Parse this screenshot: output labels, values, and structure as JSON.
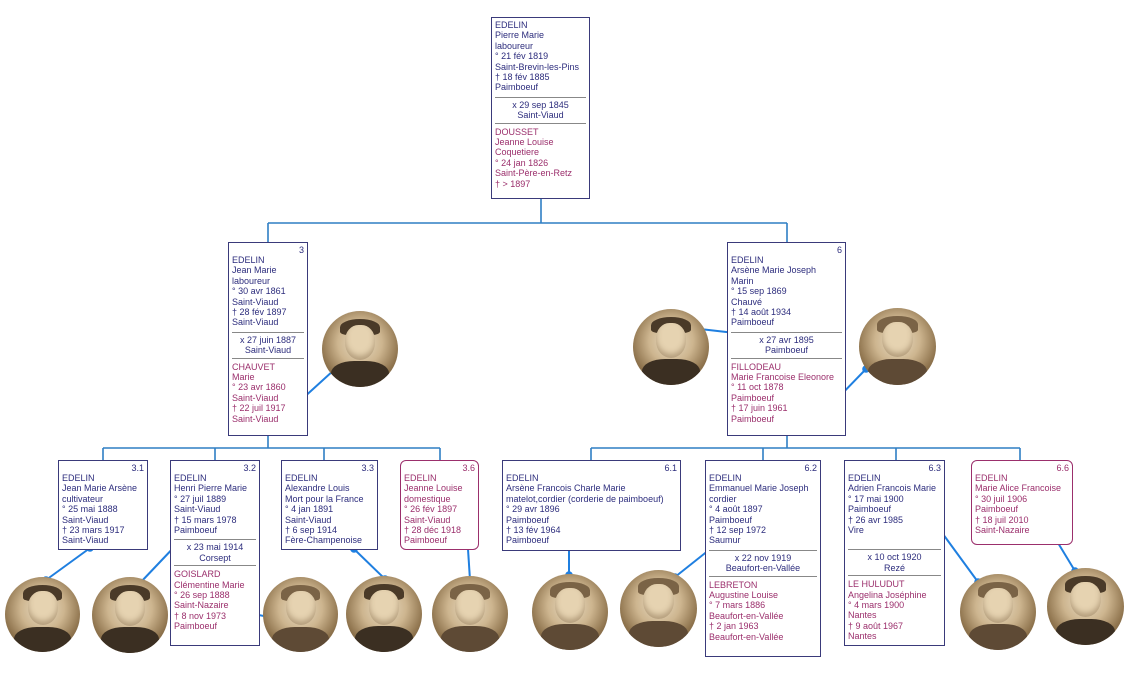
{
  "root": {
    "husband": [
      "EDELIN",
      "Pierre Marie",
      "laboureur",
      "° 21 fév 1819",
      "Saint-Brevin-les-Pins",
      "† 18 fév 1885",
      "Paimboeuf"
    ],
    "marriage": [
      "x 29 sep 1845",
      "Saint-Viaud"
    ],
    "wife": [
      "DOUSSET",
      "Jeanne Louise",
      "Coquetiere",
      "° 24 jan 1826",
      "Saint-Père-en-Retz",
      "† > 1897"
    ]
  },
  "couple3": {
    "num": "3",
    "husband": [
      "EDELIN",
      "Jean Marie",
      "laboureur",
      "° 30 avr 1861",
      "Saint-Viaud",
      "† 28 fév 1897",
      "Saint-Viaud"
    ],
    "marriage": [
      "x 27 juin 1887",
      "Saint-Viaud"
    ],
    "wife": [
      "CHAUVET",
      "Marie",
      "° 23 avr 1860",
      "Saint-Viaud",
      "† 22 juil 1917",
      "Saint-Viaud"
    ]
  },
  "couple6": {
    "num": "6",
    "husband": [
      "EDELIN",
      "Arsène Marie Joseph",
      "Marin",
      "° 15 sep 1869",
      "Chauvé",
      "† 14 août 1934",
      "Paimboeuf"
    ],
    "marriage": [
      "x 27 avr 1895",
      "Paimboeuf"
    ],
    "wife": [
      "FILLODEAU",
      "Marie Francoise Eleonore",
      "° 11 oct 1878",
      "Paimboeuf",
      "† 17 juin 1961",
      "Paimboeuf"
    ]
  },
  "p3_1": {
    "num": "3.1",
    "lines": [
      "EDELIN",
      "Jean Marie Arsène",
      "cultivateur",
      "° 25 mai 1888",
      "Saint-Viaud",
      "† 23 mars 1917",
      "Saint-Viaud"
    ]
  },
  "p3_2": {
    "num": "3.2",
    "husband": [
      "EDELIN",
      "Henri Pierre Marie",
      "° 27 juil 1889",
      "Saint-Viaud",
      "† 15 mars 1978",
      "Paimboeuf"
    ],
    "marriage": [
      "x 23 mai 1914",
      "Corsept"
    ],
    "wife": [
      "GOISLARD",
      "Clémentine Marie",
      "° 26 sep 1888",
      "Saint-Nazaire",
      "† 8 nov 1973",
      "Paimboeuf"
    ]
  },
  "p3_3": {
    "num": "3.3",
    "lines": [
      "EDELIN",
      "Alexandre Louis",
      "Mort pour la France",
      "° 4 jan 1891",
      "Saint-Viaud",
      "† 6 sep 1914",
      "Fère-Champenoise"
    ]
  },
  "p3_6": {
    "num": "3.6",
    "lines": [
      "EDELIN",
      "Jeanne Louise",
      "domestique",
      "° 26 fév 1897",
      "Saint-Viaud",
      "† 28 déc 1918",
      "Paimboeuf"
    ]
  },
  "p6_1": {
    "num": "6.1",
    "lines": [
      "EDELIN",
      "Arsène Francois Charle Marie",
      "matelot,cordier (corderie de paimboeuf)",
      "° 29 avr 1896",
      "Paimboeuf",
      "† 13 fév 1964",
      "Paimboeuf"
    ]
  },
  "p6_2": {
    "num": "6.2",
    "husband": [
      "EDELIN",
      "Emmanuel Marie Joseph",
      "cordier",
      "° 4 août 1897",
      "Paimboeuf",
      "† 12 sep 1972",
      "Saumur"
    ],
    "marriage": [
      "x 22 nov 1919",
      "Beaufort-en-Vallée"
    ],
    "wife": [
      "LEBRETON",
      "Augustine Louise",
      "° 7 mars 1886",
      "Beaufort-en-Vallée",
      "† 2 jan 1963",
      "Beaufort-en-Vallée"
    ]
  },
  "p6_3": {
    "num": "6.3",
    "husband": [
      "EDELIN",
      "Adrien Francois Marie",
      "° 17 mai 1900",
      "Paimboeuf",
      "† 26 avr 1985",
      "Vire"
    ],
    "marriage": [
      "x 10 oct 1920",
      "Rezé"
    ],
    "wife": [
      "LE HULUDUT",
      "Angelina Joséphine",
      "° 4 mars 1900",
      "Nantes",
      "† 9 août 1967",
      "Nantes"
    ]
  },
  "p6_6": {
    "num": "6.6",
    "lines": [
      "EDELIN",
      "Marie Alice Francoise",
      "° 30 juil 1906",
      "Paimboeuf",
      "† 18 juil 2010",
      "Saint-Nazaire"
    ]
  },
  "colors": {
    "male": "#2d2d7d",
    "female": "#9b2f6c",
    "connector": "#2f7fc4",
    "photoLink": "#1f7fe0"
  }
}
